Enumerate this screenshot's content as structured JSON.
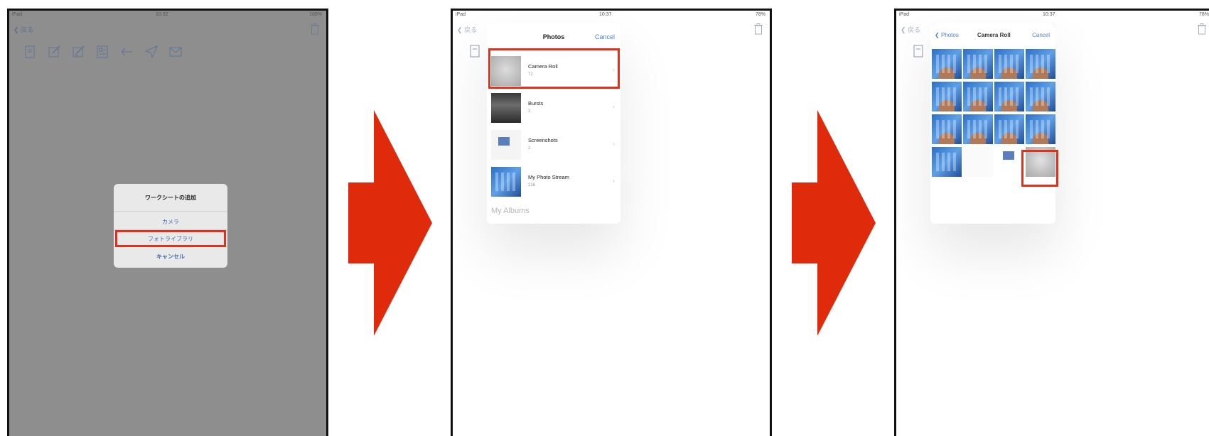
{
  "screen1": {
    "status_left": "iPad",
    "status_time": "10:32",
    "status_right": "100%",
    "back_label": "戻る",
    "alert": {
      "title": "ワークシートの追加",
      "camera": "カメラ",
      "photo_library": "フォトライブラリ",
      "cancel": "キャンセル"
    }
  },
  "screen2": {
    "status_left": "iPad",
    "status_time": "10:37",
    "status_right": "78%",
    "back_label": "戻る",
    "popover_title": "Photos",
    "cancel_label": "Cancel",
    "albums": [
      {
        "name": "Camera Roll",
        "count": "72"
      },
      {
        "name": "Bursts",
        "count": "2"
      },
      {
        "name": "Screenshots",
        "count": "2"
      },
      {
        "name": "My Photo Stream",
        "count": "226"
      }
    ],
    "my_albums_label": "My Albums"
  },
  "screen3": {
    "status_left": "iPad",
    "status_time": "10:37",
    "status_right": "78%",
    "back_label": "戻る",
    "back_to_photos": "Photos",
    "title": "Camera Roll",
    "cancel_label": "Cancel"
  },
  "colors": {
    "highlight": "#e0301e",
    "arrow": "#e02a0c",
    "ios_blue": "#4a7fd6"
  }
}
